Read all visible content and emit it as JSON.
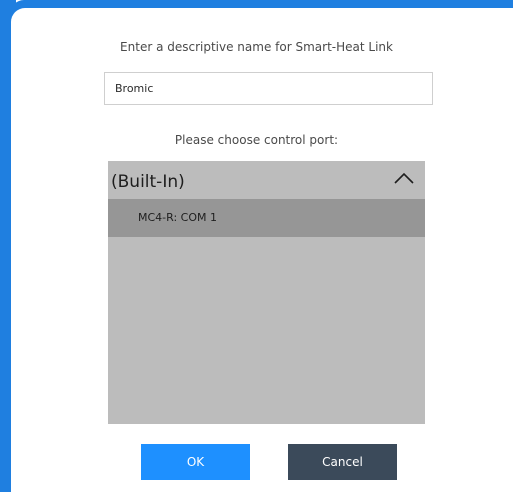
{
  "dialog": {
    "prompt": "Enter a descriptive name for Smart-Heat Link",
    "name_value": "Bromic",
    "port_prompt": "Please choose control port:"
  },
  "ports": {
    "group_label": "(Built-In)",
    "group_icon": "chevron-up-icon",
    "items": [
      {
        "label": "MC4-R: COM 1",
        "selected": true
      }
    ]
  },
  "buttons": {
    "ok_label": "OK",
    "cancel_label": "Cancel"
  },
  "colors": {
    "accent": "#1e90ff",
    "window_edge": "#1f7fe0",
    "cancel": "#3b4a5a",
    "panel": "#bcbcbc",
    "selected_item": "#969696"
  }
}
